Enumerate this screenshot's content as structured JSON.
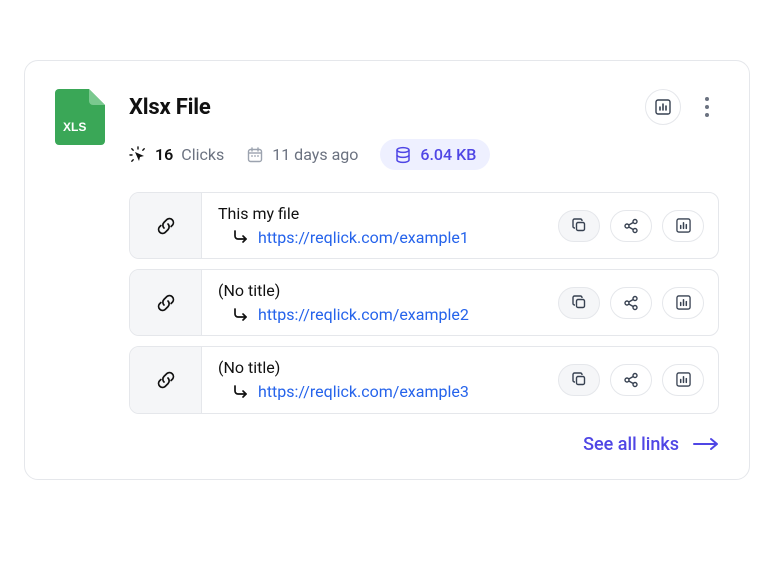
{
  "file": {
    "title": "Xlsx File",
    "icon_label": "XLS",
    "icon_color": "#3aa757",
    "clicks_count": "16",
    "clicks_label": "Clicks",
    "age_label": "11 days ago",
    "size_label": "6.04 KB"
  },
  "links": [
    {
      "title": "This my file",
      "url": "https://reqlick.com/example1"
    },
    {
      "title": "(No title)",
      "url": "https://reqlick.com/example2"
    },
    {
      "title": "(No title)",
      "url": "https://reqlick.com/example3"
    }
  ],
  "footer": {
    "see_all_label": "See all links"
  }
}
